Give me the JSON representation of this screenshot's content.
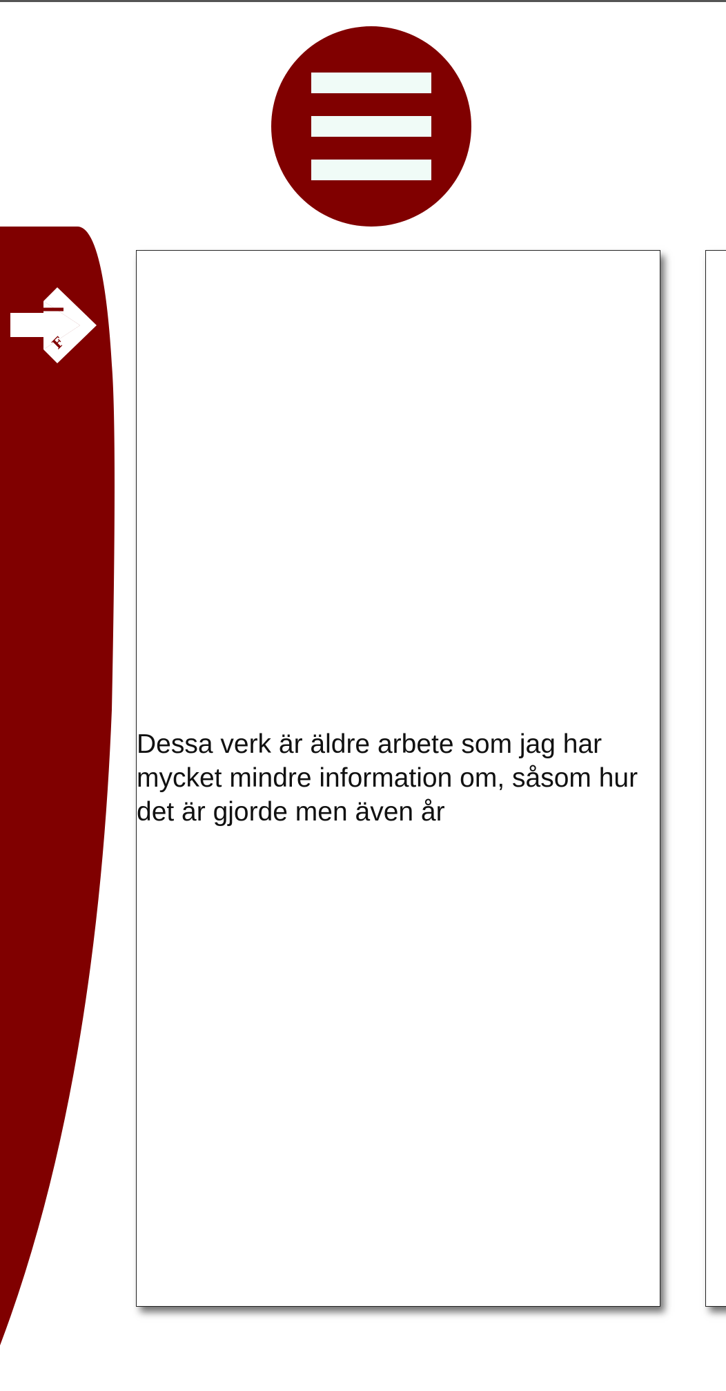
{
  "colors": {
    "brand": "#800000",
    "menu_bars": "#f0fbf7",
    "background": "#ffffff"
  },
  "menu": {
    "icon": "hamburger-menu-icon"
  },
  "sidebar": {
    "nav_icon": "arrow-right-icon"
  },
  "cards": [
    {
      "text": "Dessa verk är äldre arbete som jag har mycket mindre information om, såsom hur det är gjorde men även år"
    }
  ]
}
